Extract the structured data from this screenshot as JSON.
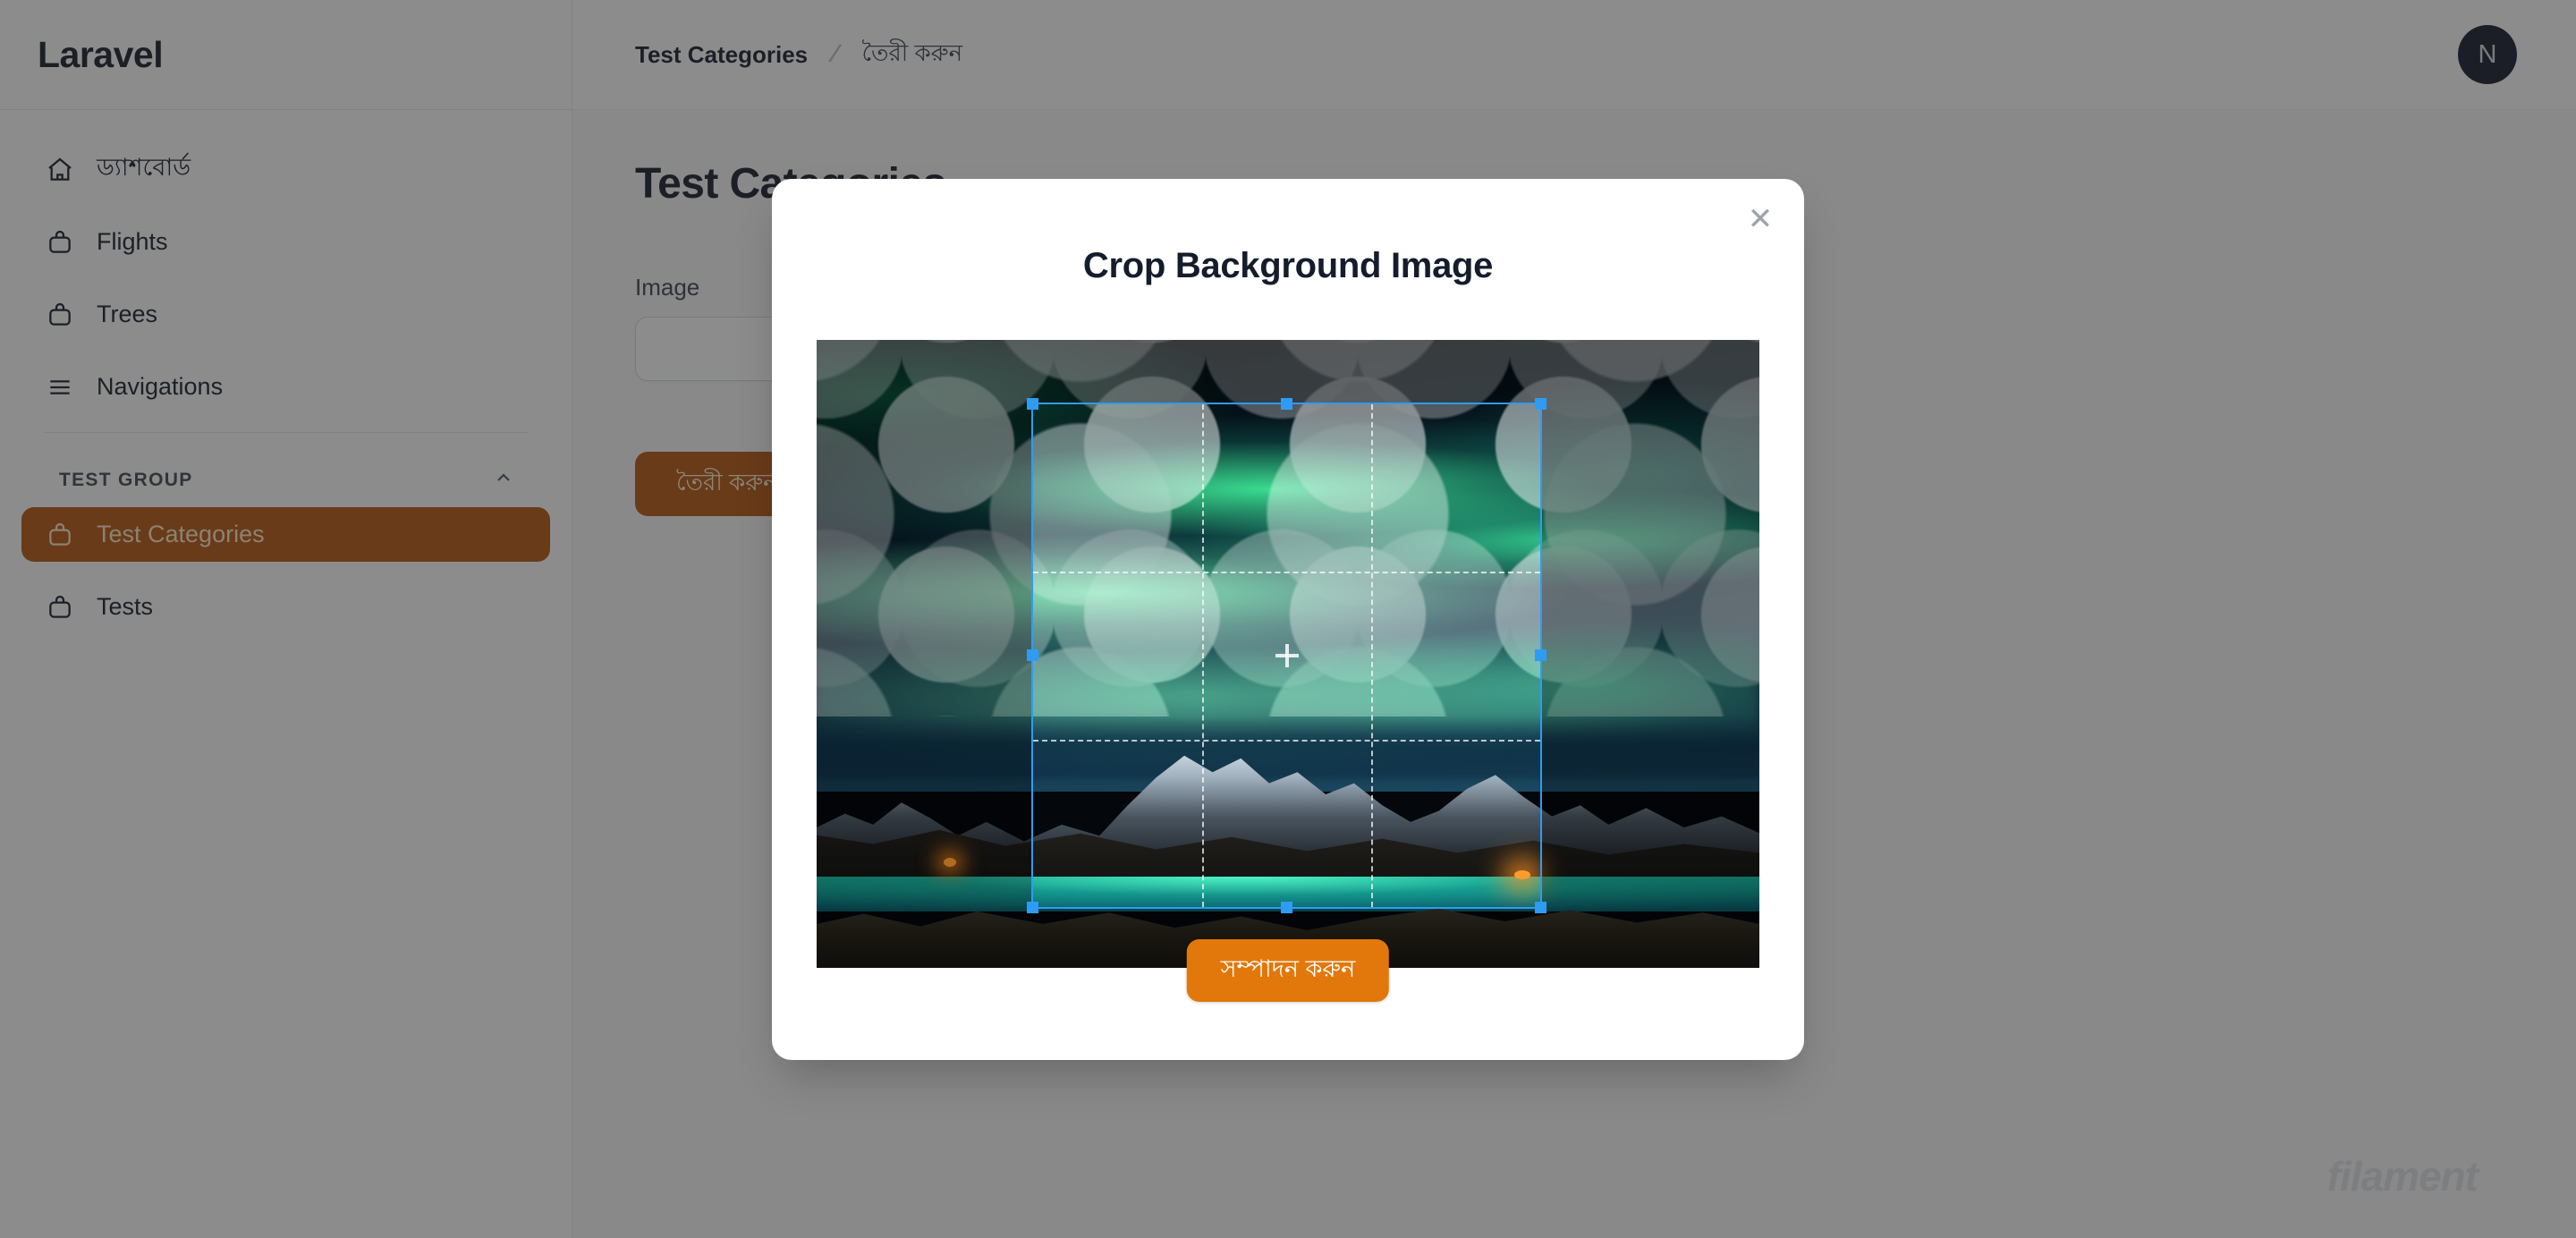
{
  "sidebar": {
    "brand": "Laravel",
    "items": [
      {
        "label": "ড্যাশবোর্ড",
        "icon": "home-icon",
        "active": false
      },
      {
        "label": "Flights",
        "icon": "box-icon",
        "active": false
      },
      {
        "label": "Trees",
        "icon": "box-icon",
        "active": false
      },
      {
        "label": "Navigations",
        "icon": "bars-icon",
        "active": false
      }
    ],
    "group": {
      "title": "TEST GROUP",
      "chevron": "chevron-up-icon",
      "items": [
        {
          "label": "Test Categories",
          "icon": "box-icon",
          "active": true
        },
        {
          "label": "Tests",
          "icon": "box-icon",
          "active": false
        }
      ]
    }
  },
  "topbar": {
    "breadcrumb": {
      "root": "Test Categories",
      "separator": "/",
      "current": "তৈরী করুন"
    },
    "avatar_initial": "N"
  },
  "page": {
    "title": "Test Categories",
    "form": {
      "image_label": "Image",
      "image_value": "",
      "image_placeholder": ""
    },
    "create_button": "তৈরী করুন",
    "watermark": "filament"
  },
  "modal": {
    "title": "Crop Background Image",
    "close_icon": "close-icon",
    "confirm_button": "সম্পাদন করুন",
    "cropper": {
      "image_alt": "aurora-borealis-over-snowy-mountains",
      "grid": "rule-of-thirds",
      "handles": [
        "top-left",
        "top-center",
        "top-right",
        "middle-left",
        "middle-right",
        "bottom-left",
        "bottom-center",
        "bottom-right"
      ],
      "center_marker": "crosshair"
    }
  },
  "colors": {
    "accent": "#b45309",
    "confirm": "#e2780c",
    "crop_outline": "#2e9cf5",
    "avatar_bg": "#0f172a",
    "overlay": "rgba(38,38,38,0.53)"
  }
}
